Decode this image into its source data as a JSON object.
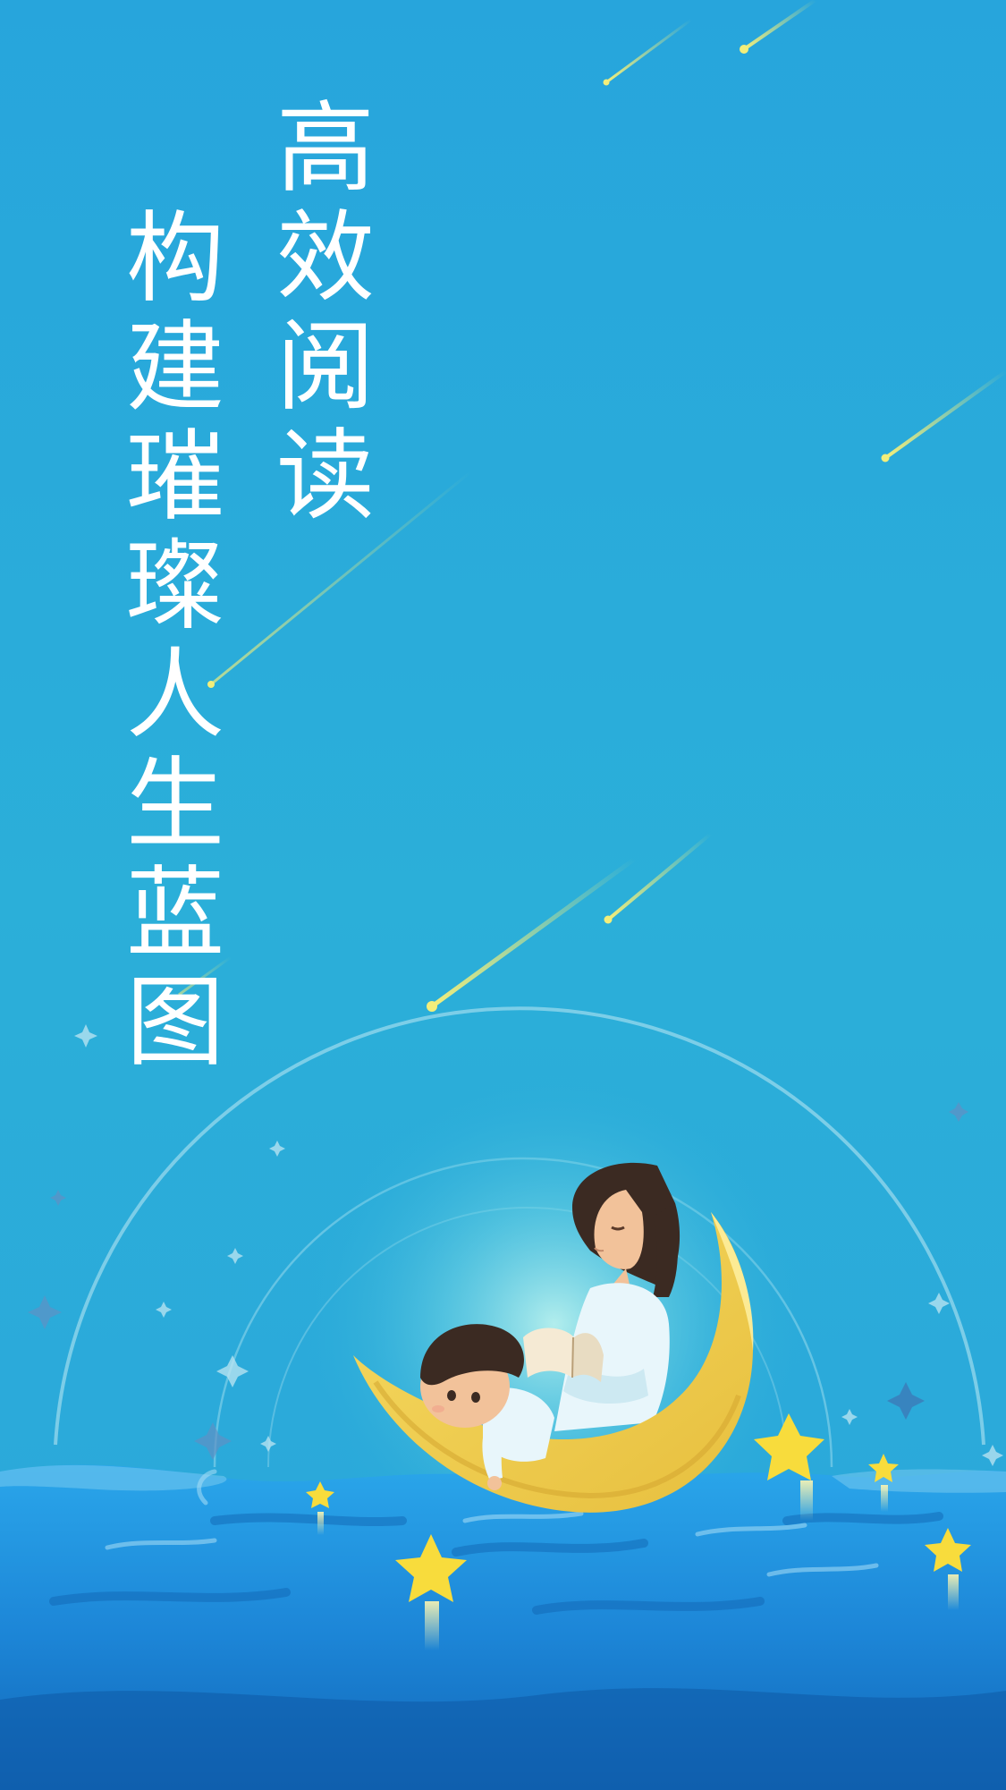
{
  "splash": {
    "headline": "高效阅读",
    "subline": "构建璀璨人生蓝图"
  },
  "illustration": {
    "subject": "mother-and-child-reading-on-crescent-moon-boat",
    "icons": [
      "shooting-star-icon",
      "star-icon",
      "moon-boat-icon",
      "book-icon",
      "sparkle-icon"
    ]
  },
  "colors": {
    "sky_top": "#27a6db",
    "sky_mid": "#2bafd9",
    "sea_light": "#2aa0e6",
    "sea_dark": "#0f5ea8",
    "moon": "#f0cf52",
    "star": "#f8dc3c",
    "meteor": "#e9e866",
    "text": "#ffffff"
  }
}
